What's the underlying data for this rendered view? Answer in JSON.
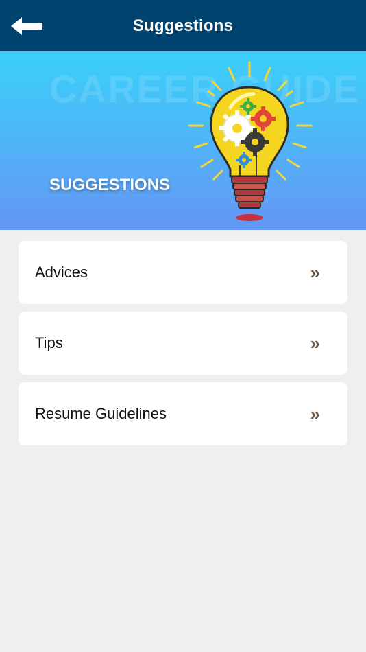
{
  "nav": {
    "title": "Suggestions",
    "back_icon": "arrow-left-icon"
  },
  "banner": {
    "watermark": "CAREER GUIDE",
    "label": "SUGGESTIONS",
    "illustration": "lightbulb-gears-icon"
  },
  "items": [
    {
      "label": "Advices",
      "chevron": "»"
    },
    {
      "label": "Tips",
      "chevron": "»"
    },
    {
      "label": "Resume Guidelines",
      "chevron": "»"
    }
  ],
  "colors": {
    "nav_bg": "#024470",
    "banner_top": "#3ad0fb",
    "banner_bottom": "#6496f5",
    "page_bg": "#efefef",
    "chevron": "#6b5a48"
  }
}
